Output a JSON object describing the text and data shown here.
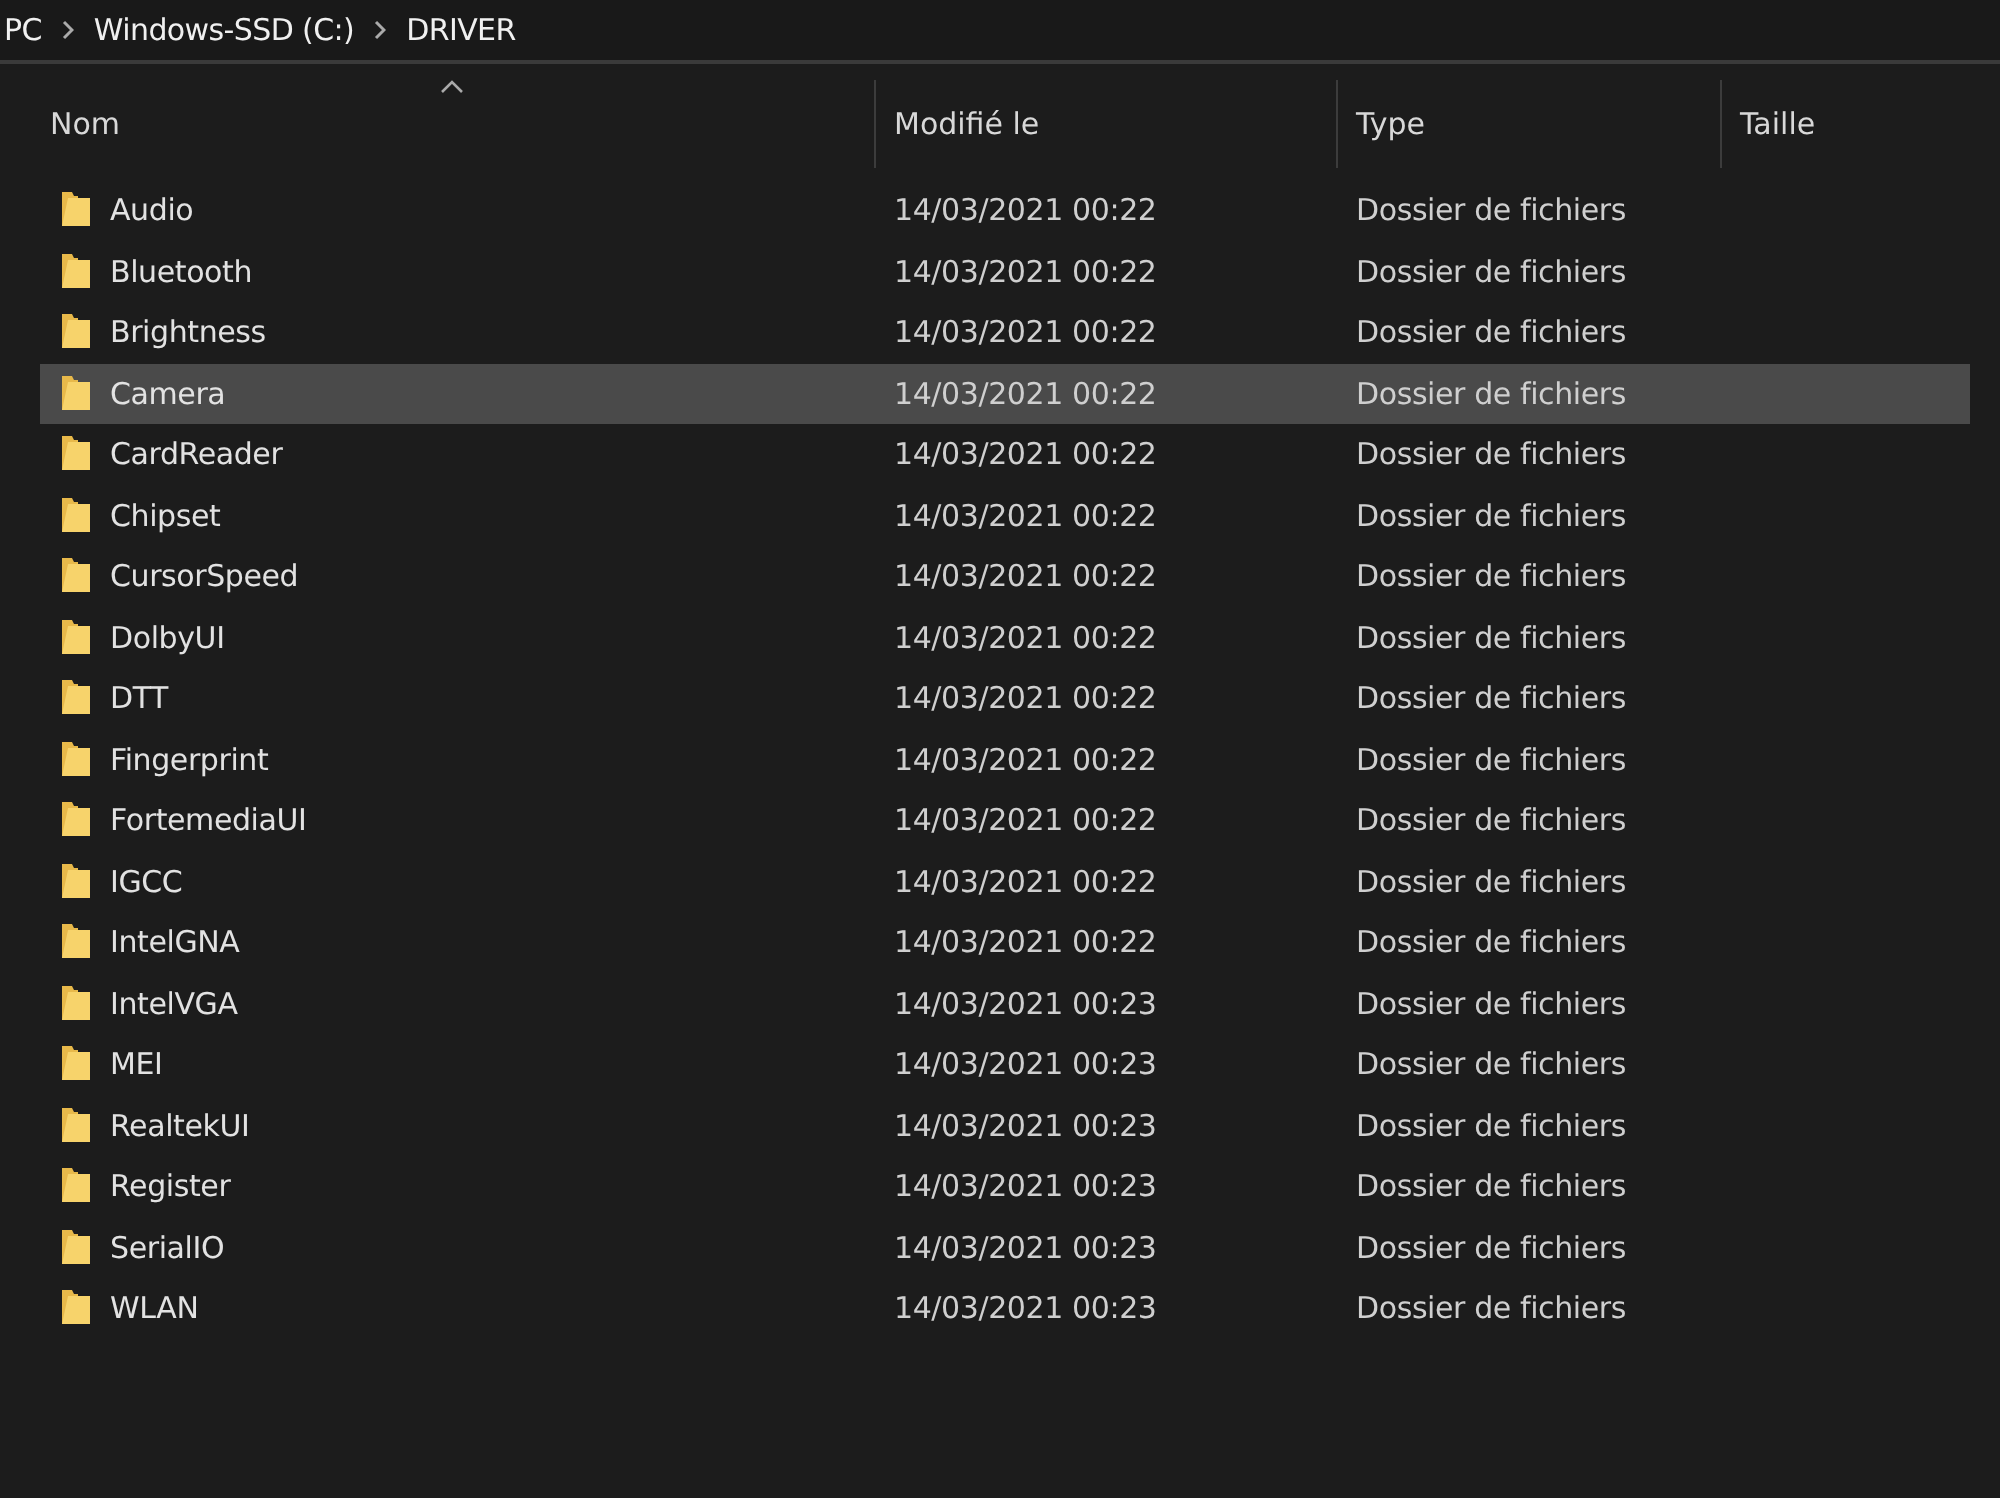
{
  "breadcrumb": [
    "PC",
    "Windows-SSD (C:)",
    "DRIVER"
  ],
  "columns": [
    "Nom",
    "Modifié le",
    "Type",
    "Taille"
  ],
  "rows": [
    {
      "name": "Audio",
      "modified": "14/03/2021 00:22",
      "type": "Dossier de fichiers",
      "selected": false
    },
    {
      "name": "Bluetooth",
      "modified": "14/03/2021 00:22",
      "type": "Dossier de fichiers",
      "selected": false
    },
    {
      "name": "Brightness",
      "modified": "14/03/2021 00:22",
      "type": "Dossier de fichiers",
      "selected": false
    },
    {
      "name": "Camera",
      "modified": "14/03/2021 00:22",
      "type": "Dossier de fichiers",
      "selected": true
    },
    {
      "name": "CardReader",
      "modified": "14/03/2021 00:22",
      "type": "Dossier de fichiers",
      "selected": false
    },
    {
      "name": "Chipset",
      "modified": "14/03/2021 00:22",
      "type": "Dossier de fichiers",
      "selected": false
    },
    {
      "name": "CursorSpeed",
      "modified": "14/03/2021 00:22",
      "type": "Dossier de fichiers",
      "selected": false
    },
    {
      "name": "DolbyUI",
      "modified": "14/03/2021 00:22",
      "type": "Dossier de fichiers",
      "selected": false
    },
    {
      "name": "DTT",
      "modified": "14/03/2021 00:22",
      "type": "Dossier de fichiers",
      "selected": false
    },
    {
      "name": "Fingerprint",
      "modified": "14/03/2021 00:22",
      "type": "Dossier de fichiers",
      "selected": false
    },
    {
      "name": "FortemediaUI",
      "modified": "14/03/2021 00:22",
      "type": "Dossier de fichiers",
      "selected": false
    },
    {
      "name": "IGCC",
      "modified": "14/03/2021 00:22",
      "type": "Dossier de fichiers",
      "selected": false
    },
    {
      "name": "IntelGNA",
      "modified": "14/03/2021 00:22",
      "type": "Dossier de fichiers",
      "selected": false
    },
    {
      "name": "IntelVGA",
      "modified": "14/03/2021 00:23",
      "type": "Dossier de fichiers",
      "selected": false
    },
    {
      "name": "MEI",
      "modified": "14/03/2021 00:23",
      "type": "Dossier de fichiers",
      "selected": false
    },
    {
      "name": "RealtekUI",
      "modified": "14/03/2021 00:23",
      "type": "Dossier de fichiers",
      "selected": false
    },
    {
      "name": "Register",
      "modified": "14/03/2021 00:23",
      "type": "Dossier de fichiers",
      "selected": false
    },
    {
      "name": "SerialIO",
      "modified": "14/03/2021 00:23",
      "type": "Dossier de fichiers",
      "selected": false
    },
    {
      "name": "WLAN",
      "modified": "14/03/2021 00:23",
      "type": "Dossier de fichiers",
      "selected": false
    }
  ]
}
